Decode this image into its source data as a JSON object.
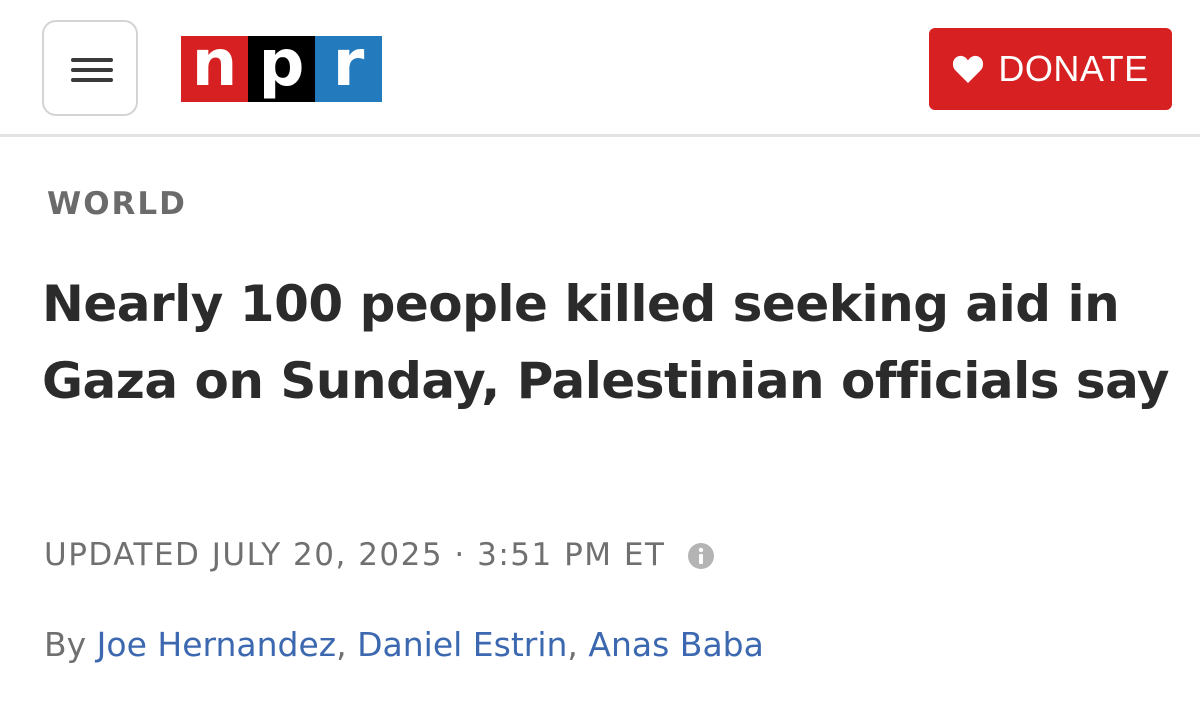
{
  "header": {
    "logo": {
      "letters": [
        "n",
        "p",
        "r"
      ]
    },
    "donate": {
      "label": "DONATE"
    }
  },
  "article": {
    "section": "WORLD",
    "headline": "Nearly 100 people killed seeking aid in Gaza on Sunday, Palestinian officials say",
    "updated": "UPDATED JULY 20, 2025 · 3:51 PM ET",
    "byline": {
      "prefix": "By ",
      "authors": [
        "Joe Hernandez",
        "Daniel Estrin",
        "Anas Baba"
      ],
      "separator": ", "
    }
  },
  "colors": {
    "brand_red": "#d62021",
    "brand_blue": "#237bbd",
    "link_blue": "#3c68b0",
    "headline": "#2b2b2b",
    "muted": "#707070"
  },
  "icons": {
    "menu": "hamburger-menu-icon",
    "donate": "heart-icon",
    "timestamp_info": "info-icon"
  }
}
